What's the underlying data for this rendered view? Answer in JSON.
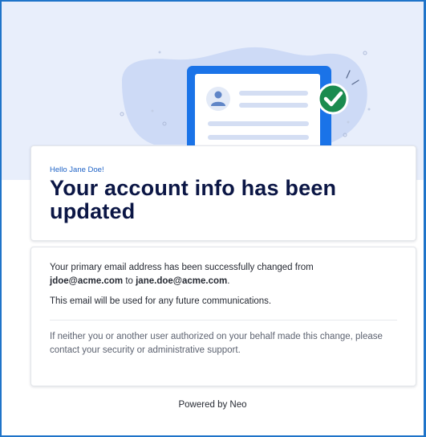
{
  "greeting": "Hello Jane Doe!",
  "title": "Your account info has been updated",
  "message": {
    "line1_prefix": "Your primary email address has been successfully changed from",
    "old_email": "jdoe@acme.com",
    "connector": "to",
    "new_email": "jane.doe@acme.com",
    "end_punct": ".",
    "line2": "This email will be used for any future communications."
  },
  "security_note": "If neither you or another user authorized on your behalf made this change, please contact your security or administrative support.",
  "footer": "Powered by Neo",
  "colors": {
    "frame_border": "#1f74c9",
    "hero_background": "#e8eefb",
    "title_text": "#0b1645",
    "greeting_text": "#1f63c6",
    "checkmark_badge": "#1a8b4f"
  },
  "icons": [
    "document-illustration",
    "avatar-icon",
    "checkmark-badge-icon"
  ]
}
